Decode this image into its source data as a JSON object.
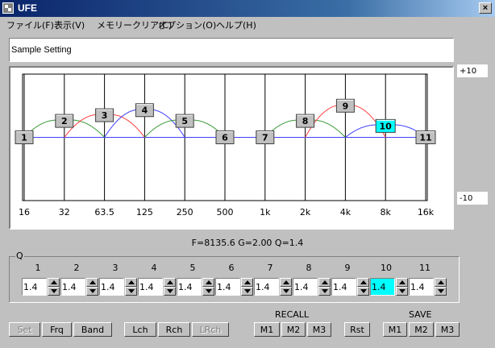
{
  "window": {
    "title": "UFE",
    "close_label": "×"
  },
  "menu": [
    {
      "label": "ファイル(F)"
    },
    {
      "label": "表示(V)"
    },
    {
      "label": "メモリークリア(C)"
    },
    {
      "label": "オプション(O)"
    },
    {
      "label": "ヘルプ(H)"
    }
  ],
  "setting_name": "Sample Setting",
  "range": {
    "top_label": "+10",
    "bottom_label": "-10"
  },
  "freq_labels": [
    "16",
    "32",
    "63.5",
    "125",
    "250",
    "500",
    "1k",
    "2k",
    "4k",
    "8k",
    "16k"
  ],
  "bands": [
    {
      "label": "1",
      "level": 0.0,
      "selected": false
    },
    {
      "label": "2",
      "level": 2.6,
      "selected": false
    },
    {
      "label": "3",
      "level": 3.5,
      "selected": false
    },
    {
      "label": "4",
      "level": 4.3,
      "selected": false
    },
    {
      "label": "5",
      "level": 2.6,
      "selected": false
    },
    {
      "label": "6",
      "level": 0.0,
      "selected": false
    },
    {
      "label": "7",
      "level": 0.0,
      "selected": false
    },
    {
      "label": "8",
      "level": 2.6,
      "selected": false
    },
    {
      "label": "9",
      "level": 5.0,
      "selected": false
    },
    {
      "label": "10",
      "level": 1.8,
      "selected": true
    },
    {
      "label": "11",
      "level": 0.0,
      "selected": false
    }
  ],
  "status": "F=8135.6 G=2.00 Q=1.4",
  "q_group": {
    "legend": "Q",
    "items": [
      {
        "num": "1",
        "value": "1.4"
      },
      {
        "num": "2",
        "value": "1.4"
      },
      {
        "num": "3",
        "value": "1.4"
      },
      {
        "num": "4",
        "value": "1.4"
      },
      {
        "num": "5",
        "value": "1.4"
      },
      {
        "num": "6",
        "value": "1.4"
      },
      {
        "num": "7",
        "value": "1.4"
      },
      {
        "num": "8",
        "value": "1.4"
      },
      {
        "num": "9",
        "value": "1.4"
      },
      {
        "num": "10",
        "value": "1.4"
      },
      {
        "num": "11",
        "value": "1.4"
      }
    ]
  },
  "buttons": {
    "set": "Set",
    "frq": "Frq",
    "band": "Band",
    "lch": "Lch",
    "rch": "Rch",
    "lrch": "LRch",
    "recall_label": "RECALL",
    "recall_m1": "M1",
    "recall_m2": "M2",
    "recall_m3": "M3",
    "rst": "Rst",
    "save_label": "SAVE",
    "save_m1": "M1",
    "save_m2": "M2",
    "save_m3": "M3"
  },
  "colors": {
    "flat_line": "#4040ff",
    "curve_green": "#3a9a3a",
    "curve_red": "#ff4040",
    "curve_blue": "#4040ff",
    "selected_band": "#00ffff"
  }
}
